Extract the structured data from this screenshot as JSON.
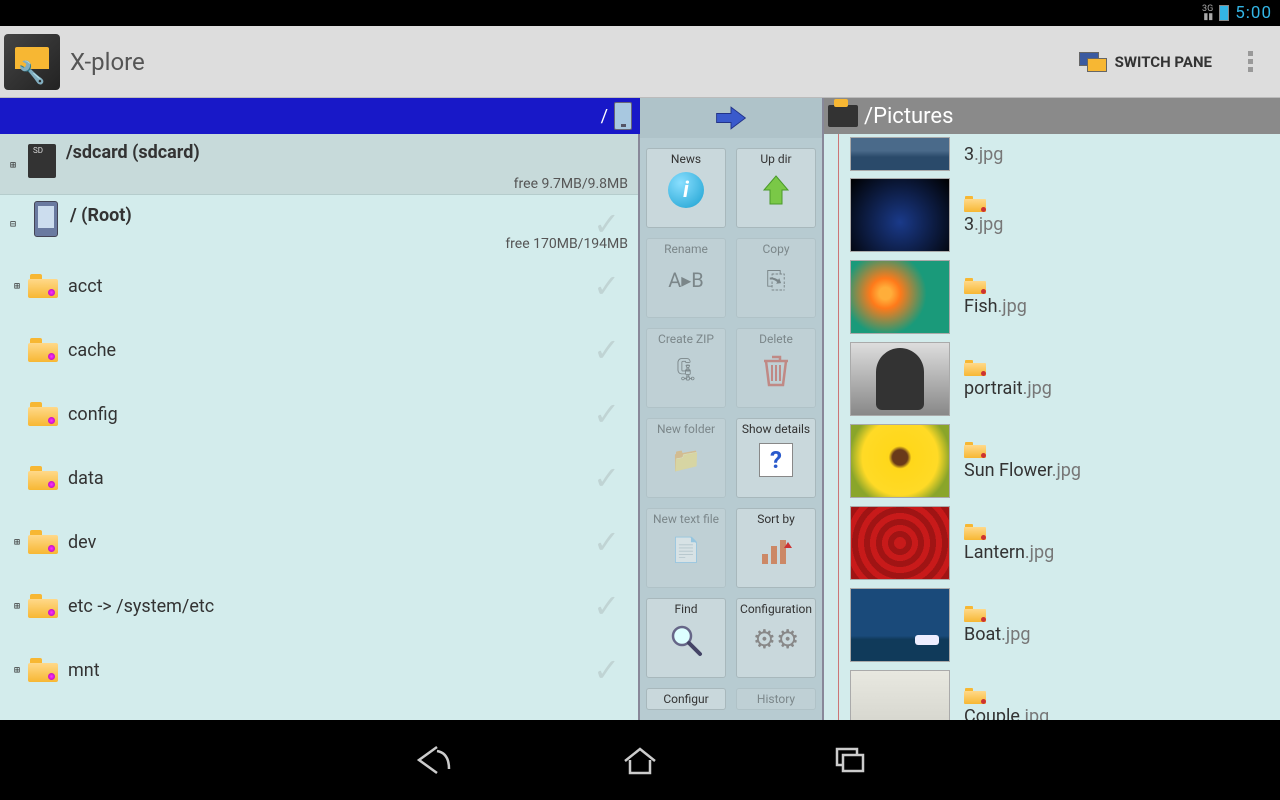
{
  "status": {
    "network": "3G",
    "time": "5:00"
  },
  "actionbar": {
    "title": "X-plore",
    "switch_pane": "SWITCH PANE"
  },
  "left": {
    "path": "/",
    "sdcard": {
      "label": "/sdcard (sdcard)",
      "free": "free 9.7MB/9.8MB"
    },
    "root": {
      "label": "/ (Root)",
      "free": "free 170MB/194MB"
    },
    "dirs": [
      {
        "name": "acct",
        "expand": "⊞"
      },
      {
        "name": "cache",
        "expand": ""
      },
      {
        "name": "config",
        "expand": ""
      },
      {
        "name": "data",
        "expand": ""
      },
      {
        "name": "dev",
        "expand": "⊞"
      },
      {
        "name": "etc -> /system/etc",
        "expand": "⊞"
      },
      {
        "name": "mnt",
        "expand": "⊞"
      }
    ]
  },
  "toolbar": {
    "buttons": [
      {
        "label": "News",
        "enabled": true,
        "icon": "info"
      },
      {
        "label": "Up dir",
        "enabled": true,
        "icon": "up"
      },
      {
        "label": "Rename",
        "enabled": false,
        "icon": "rename"
      },
      {
        "label": "Copy",
        "enabled": false,
        "icon": "copy"
      },
      {
        "label": "Create ZIP",
        "enabled": false,
        "icon": "zip"
      },
      {
        "label": "Delete",
        "enabled": false,
        "icon": "trash"
      },
      {
        "label": "New folder",
        "enabled": false,
        "icon": "newfold"
      },
      {
        "label": "Show details",
        "enabled": true,
        "icon": "details"
      },
      {
        "label": "New text file",
        "enabled": false,
        "icon": "newtxt"
      },
      {
        "label": "Sort by",
        "enabled": true,
        "icon": "sort"
      },
      {
        "label": "Find",
        "enabled": true,
        "icon": "find"
      },
      {
        "label": "Configuration",
        "enabled": true,
        "icon": "gears"
      },
      {
        "label": "Configur",
        "enabled": true,
        "icon": ""
      },
      {
        "label": "History",
        "enabled": false,
        "icon": ""
      }
    ]
  },
  "right": {
    "path": "/Pictures",
    "files": [
      {
        "name": "3",
        "ext": ".jpg",
        "first": true,
        "thumb": "th1"
      },
      {
        "name": "3",
        "ext": ".jpg",
        "thumb": "th2"
      },
      {
        "name": "Fish",
        "ext": ".jpg",
        "thumb": "th3"
      },
      {
        "name": "portrait",
        "ext": ".jpg",
        "thumb": "th4"
      },
      {
        "name": "Sun Flower",
        "ext": ".jpg",
        "thumb": "th5"
      },
      {
        "name": "Lantern",
        "ext": ".jpg",
        "thumb": "th6"
      },
      {
        "name": "Boat",
        "ext": ".jpg",
        "thumb": "th7"
      },
      {
        "name": "Couple",
        "ext": ".jpg",
        "thumb": "th8"
      }
    ]
  }
}
